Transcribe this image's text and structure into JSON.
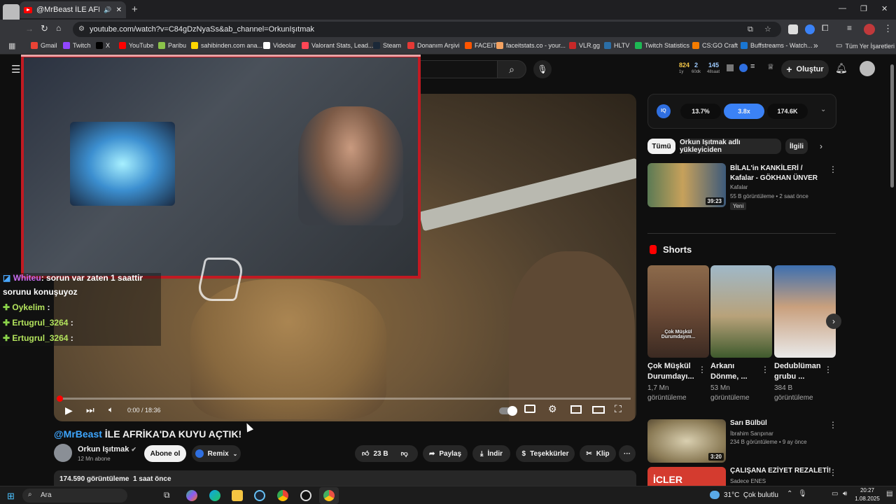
{
  "browser": {
    "tab_title": "@MrBeast İLE AFRİKA'DA K",
    "new_tab": "+",
    "url": "youtube.com/watch?v=C84gDzNyaSs&ab_channel=OrkunIşıtmak",
    "window_controls": [
      "—",
      "❐",
      "✕"
    ],
    "bookmarks": [
      {
        "label": "Gmail",
        "color": "#ea4335"
      },
      {
        "label": "Twitch",
        "color": "#9146ff"
      },
      {
        "label": "X",
        "color": "#000000"
      },
      {
        "label": "YouTube",
        "color": "#ff0000"
      },
      {
        "label": "Paribu",
        "color": "#8bc34a"
      },
      {
        "label": "sahibinden.com ana...",
        "color": "#ffd600"
      },
      {
        "label": "Videolar",
        "color": "#ffffff"
      },
      {
        "label": "Valorant Stats, Lead...",
        "color": "#ff4655"
      },
      {
        "label": "Steam",
        "color": "#1b2838"
      },
      {
        "label": "Donanım Arşivi",
        "color": "#e53935"
      },
      {
        "label": "FACEIT",
        "color": "#ff5500"
      },
      {
        "label": "faceitstats.co - your...",
        "color": "#f4a261"
      },
      {
        "label": "VLR.gg",
        "color": "#c62828"
      },
      {
        "label": "HLTV",
        "color": "#2b6ea6"
      },
      {
        "label": "Twitch Statistics",
        "color": "#1db954"
      },
      {
        "label": "CS:GO Craft",
        "color": "#f57c00"
      },
      {
        "label": "Buffstreams - Watch...",
        "color": "#1976d2"
      }
    ],
    "bookmarks_more": "»",
    "all_bookmarks": "Tüm Yer İşaretleri"
  },
  "youtube": {
    "header": {
      "stats_top": [
        "824",
        "2",
        "145"
      ],
      "stats_bottom": [
        "1y",
        "60dk",
        "48saat"
      ],
      "create_label": "Oluştur"
    },
    "video": {
      "time": "0:00 / 18:36",
      "title_mention": "@MrBeast",
      "title_rest": " İLE AFRİKA'DA KUYU AÇTIK!",
      "channel": "Orkun Işıtmak",
      "subscribers": "12 Mn abone",
      "subscribe_label": "Abone ol",
      "remix_label": "Remix",
      "likes": "23 B",
      "share_label": "Paylaş",
      "download_label": "İndir",
      "thanks_label": "Teşekkürler",
      "clip_label": "Klip",
      "more": "···",
      "views_line": "174.590 görüntüleme  1 saat önce"
    },
    "iq_bar": {
      "badge": "IQ",
      "values": [
        "13.7%",
        "3.8x",
        "174.6K"
      ]
    },
    "filter_chips": [
      "Tümü",
      "Orkun Işıtmak adlı yükleyiciden",
      "İlgili"
    ],
    "recommendation": {
      "title": "BİLAL'in KANKİLERİ / Kafalar - GÖKHAN ÜNVER",
      "channel": "Kafalar",
      "meta": "55 B görüntüleme • 2 saat önce",
      "badge": "Yeni",
      "duration": "39:23"
    },
    "shorts_heading": "Shorts",
    "shorts": [
      {
        "title": "Çok Müşkül Durumdayı...",
        "views": "1,7 Mn görüntüleme",
        "overlay": "Çok Müşkül Durumdayım..."
      },
      {
        "title": "Arkanı Dönme, ...",
        "views": "53 Mn görüntüleme"
      },
      {
        "title": "Dedublüman grubu ...",
        "views": "384 B görüntüleme"
      }
    ],
    "more_videos": [
      {
        "title": "Sarı Bülbül",
        "channel": "İbrahim Sarıpınar",
        "meta": "234 B görüntüleme • 9 ay önce",
        "duration": "3:20"
      },
      {
        "title": "ÇALIŞANA EZİYET REZALETİ!",
        "channel": "Sadece ENES",
        "meta": "",
        "thumb_text": "İCLER"
      }
    ]
  },
  "stream_chat": [
    {
      "user": "Whiteu",
      "message": ": sorun var zaten 1 saattir"
    },
    {
      "user": "",
      "message": "sorunu konuşuyoz"
    },
    {
      "user": "Oykelim",
      "message": " :"
    },
    {
      "user": "Ertugrul_3264",
      "message": " :"
    },
    {
      "user": "Ertugrul_3264",
      "message": " :"
    }
  ],
  "taskbar": {
    "search_label": "Ara",
    "weather": "31°C  Çok bulutlu",
    "time": "20:27",
    "date": "1.08.2025"
  }
}
